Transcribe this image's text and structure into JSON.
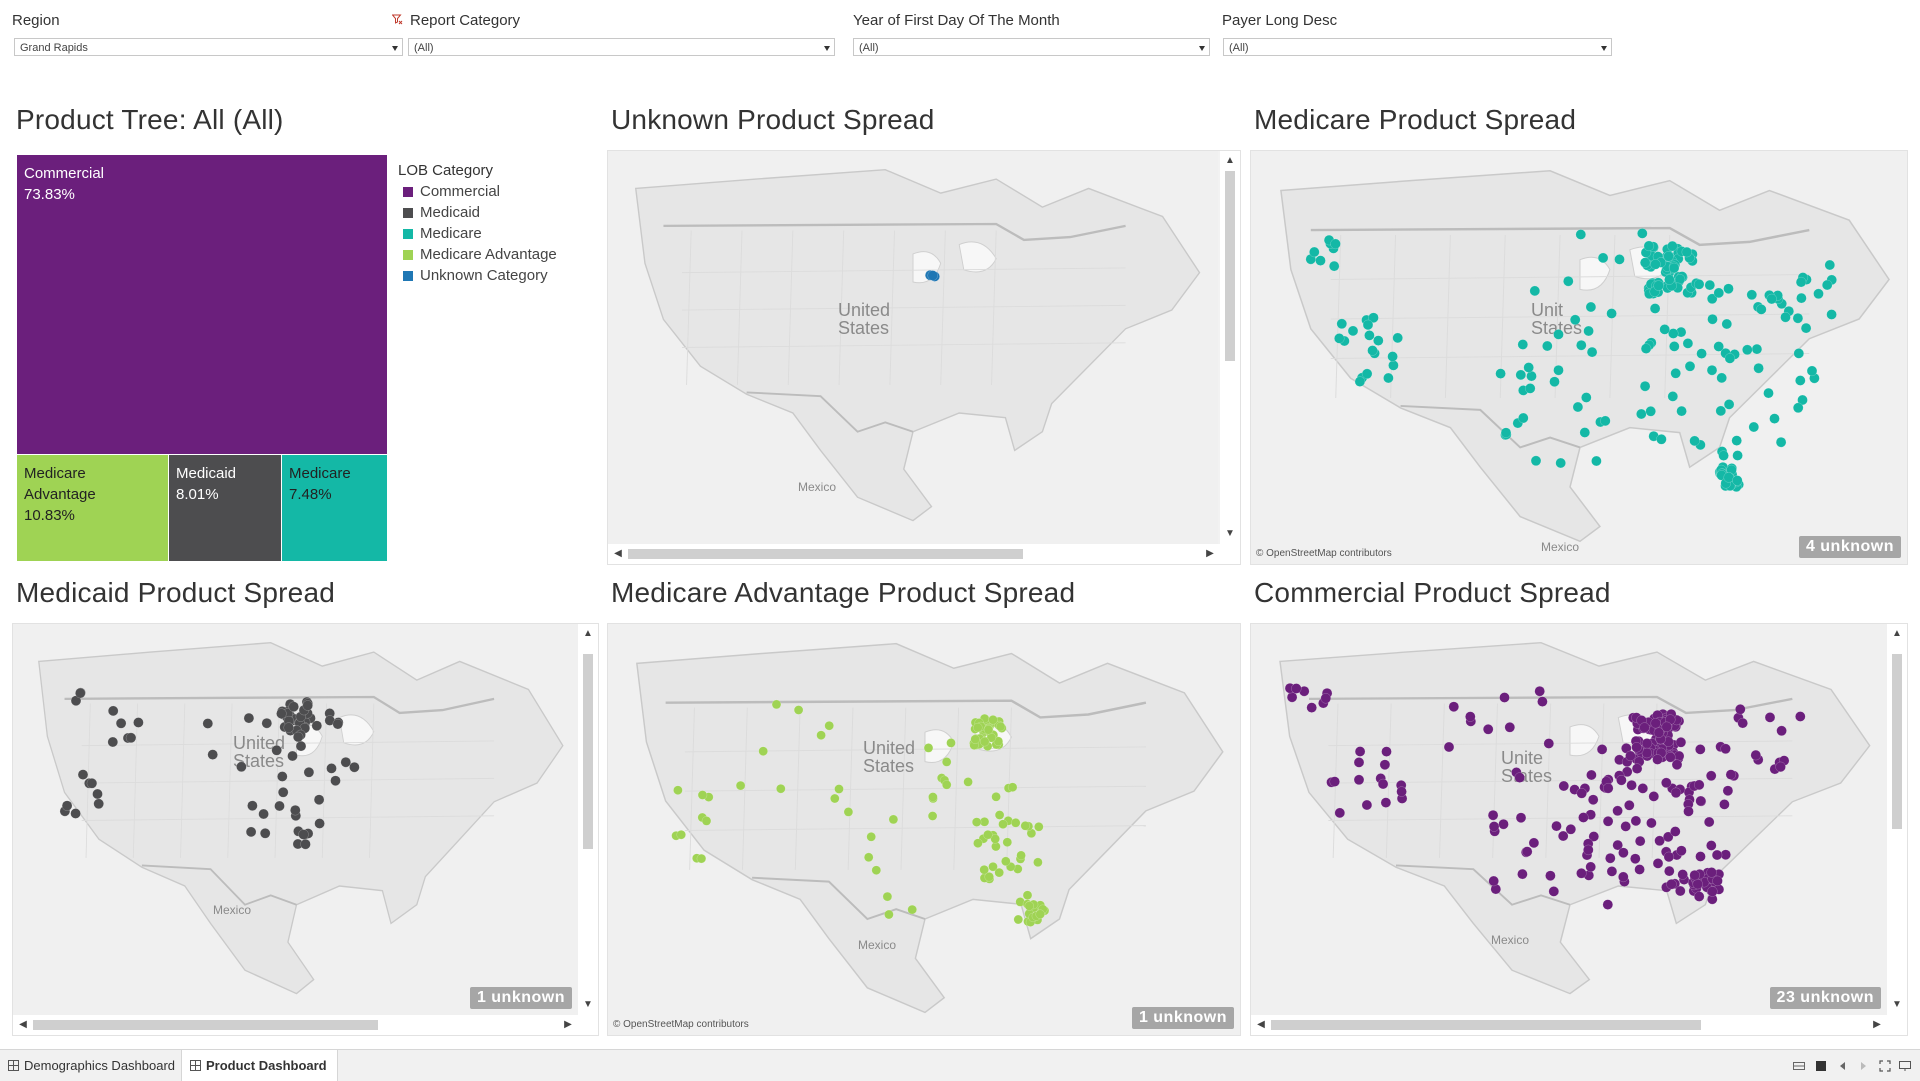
{
  "filters": [
    {
      "label": "Region",
      "value": "Grand Rapids"
    },
    {
      "label": "Report Category",
      "value": "(All)"
    },
    {
      "label": "Year of First Day Of The Month",
      "value": "(All)"
    },
    {
      "label": "Payer Long Desc",
      "value": "(All)"
    }
  ],
  "treemap": {
    "title": "Product Tree: All (All)",
    "cells": [
      {
        "name": "Commercial",
        "pct": "73.83%",
        "color": "#6b1f7c"
      },
      {
        "name": "Medicare Advantage",
        "pct": "10.83%",
        "color": "#9fd354"
      },
      {
        "name": "Medicaid",
        "pct": "8.01%",
        "color": "#4d4d4f"
      },
      {
        "name": "Medicare",
        "pct": "7.48%",
        "color": "#14b8a6"
      }
    ]
  },
  "legend": {
    "title": "LOB Category",
    "items": [
      {
        "label": "Commercial",
        "color": "#6b1f7c"
      },
      {
        "label": "Medicaid",
        "color": "#4d4d4f"
      },
      {
        "label": "Medicare",
        "color": "#14b8a6"
      },
      {
        "label": "Medicare Advantage",
        "color": "#9fd354"
      },
      {
        "label": "Unknown Category",
        "color": "#1f77b4"
      }
    ]
  },
  "maps": {
    "unknown": {
      "title": "Unknown Product Spread",
      "color": "#1f77b4",
      "country_label": [
        "United",
        "States"
      ],
      "mexico_label": "Mexico"
    },
    "medicare": {
      "title": "Medicare Product Spread",
      "color": "#14b8a6",
      "country_label": [
        "Unit",
        "States"
      ],
      "mexico_label": "Mexico",
      "attribution": "© OpenStreetMap contributors",
      "unknown_badge": "4 unknown"
    },
    "medicaid": {
      "title": "Medicaid Product Spread",
      "color": "#4d4d4f",
      "country_label": [
        "United",
        "States"
      ],
      "mexico_label": "Mexico",
      "unknown_badge": "1 unknown"
    },
    "medicare_advantage": {
      "title": "Medicare Advantage Product Spread",
      "color": "#9fd354",
      "country_label": [
        "United",
        "States"
      ],
      "mexico_label": "Mexico",
      "attribution": "© OpenStreetMap contributors",
      "unknown_badge": "1 unknown"
    },
    "commercial": {
      "title": "Commercial Product Spread",
      "color": "#6b1f7c",
      "country_label": [
        "Unite",
        "States"
      ],
      "mexico_label": "Mexico",
      "unknown_badge": "23 unknown"
    }
  },
  "tabs": [
    {
      "label": "Demographics Dashboard",
      "active": false
    },
    {
      "label": "Product Dashboard",
      "active": true
    }
  ],
  "icons": {
    "filter_funnel": "funnel-icon",
    "dropdown": "chevron-down-icon",
    "tab": "dashboard-grid-icon"
  }
}
